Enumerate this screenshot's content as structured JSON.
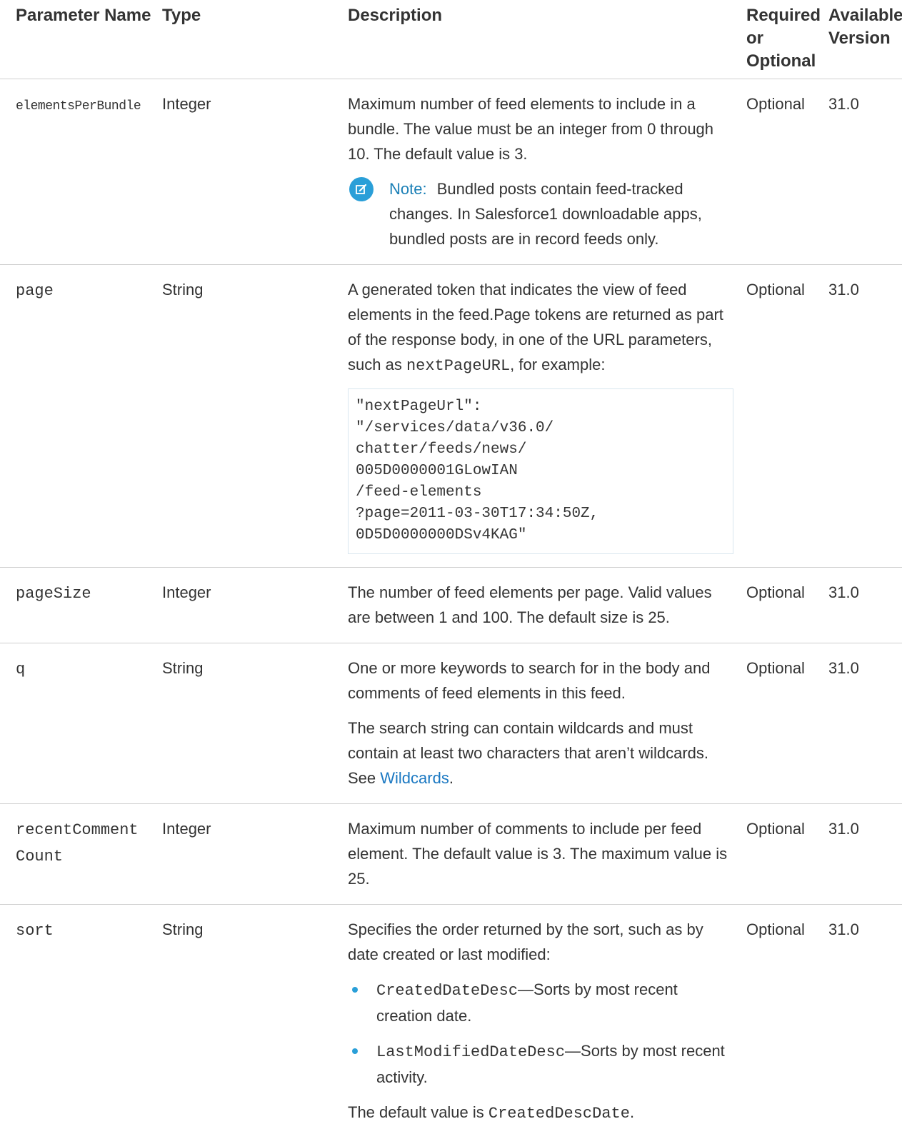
{
  "headers": {
    "name": "Parameter Name",
    "type": "Type",
    "description": "Description",
    "required": "Required or Optional",
    "version": "Available Version"
  },
  "rows": [
    {
      "name": "elementsPerBundle",
      "type": "Integer",
      "desc": "Maximum number of feed elements to include in a bundle. The value must be an integer from 0 through 10. The default value is 3.",
      "note_label": "Note:",
      "note_text": "Bundled posts contain feed-tracked changes. In Salesforce1 downloadable apps, bundled posts are in record feeds only.",
      "required": "Optional",
      "version": "31.0"
    },
    {
      "name": "page",
      "type": "String",
      "desc_before": "A generated token that indicates the view of feed elements in the feed.Page tokens are returned as part of the response body, in one of the URL parameters, such as ",
      "desc_code": "nextPageURL",
      "desc_after": ", for example:",
      "code": "\"nextPageUrl\":\n\"/services/data/v36.0/\nchatter/feeds/news/\n005D0000001GLowIAN\n/feed-elements\n?page=2011-03-30T17:34:50Z,\n0D5D0000000DSv4KAG\"",
      "required": "Optional",
      "version": "31.0"
    },
    {
      "name": "pageSize",
      "type": "Integer",
      "desc": "The number of feed elements per page. Valid values are between 1 and 100. The default size is 25.",
      "required": "Optional",
      "version": "31.0"
    },
    {
      "name": "q",
      "type": "String",
      "desc": "One or more keywords to search for in the body and comments of feed elements in this feed.",
      "desc2_before": "The search string can contain wildcards and must contain at least two characters that aren’t wildcards. See ",
      "desc2_link": "Wildcards",
      "desc2_after": ".",
      "required": "Optional",
      "version": "31.0"
    },
    {
      "name": "recentCommentCount",
      "name_line1": "recentComment",
      "name_line2": "Count",
      "type": "Integer",
      "desc": "Maximum number of comments to include per feed element. The default value is 3. The maximum value is 25.",
      "required": "Optional",
      "version": "31.0"
    },
    {
      "name": "sort",
      "type": "String",
      "desc": "Specifies the order returned by the sort, such as by date created or last modified:",
      "bullets": [
        {
          "code": "CreatedDateDesc",
          "text": "—Sorts by most recent creation date."
        },
        {
          "code": "LastModifiedDateDesc",
          "text": "—Sorts by most recent activity."
        }
      ],
      "footer_before": "The default value is ",
      "footer_code": "CreatedDescDate",
      "footer_after": ".",
      "required": "Optional",
      "version": "31.0"
    }
  ],
  "colors": {
    "accent": "#2a9fd8",
    "link": "#1a78c2",
    "note_label": "#1a7fb6",
    "divider": "#d0d0d0"
  }
}
